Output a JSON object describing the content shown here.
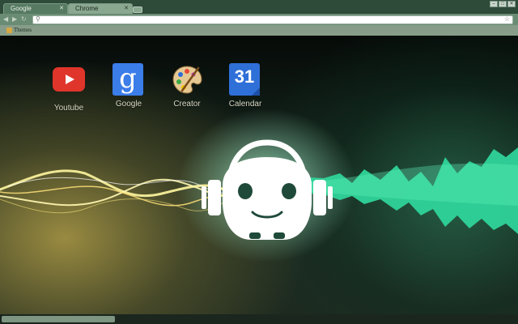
{
  "tabs": [
    {
      "label": "Google",
      "active": false
    },
    {
      "label": "Chrome",
      "active": true
    }
  ],
  "toolbar": {
    "back_icon": "back-arrow-icon",
    "forward_icon": "forward-arrow-icon",
    "reload_icon": "reload-icon",
    "omnibox": {
      "value": "",
      "placeholder": ""
    }
  },
  "bookmarks": [
    {
      "label": "Themes",
      "icon": "folder-icon"
    }
  ],
  "apps": [
    {
      "label": "Youtube",
      "icon": "youtube-icon"
    },
    {
      "label": "Google",
      "icon": "google-icon"
    },
    {
      "label": "Creator",
      "icon": "palette-icon"
    },
    {
      "label": "Calendar",
      "icon": "calendar-icon",
      "icon_text": "31"
    }
  ],
  "colors": {
    "frame": "#3d5a45",
    "wave_yellow": "#f4e98a",
    "wave_green": "#34d69e",
    "mascot": "#ffffff"
  }
}
